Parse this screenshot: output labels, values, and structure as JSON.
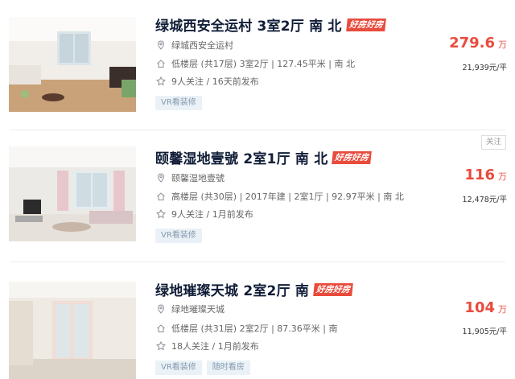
{
  "listings": [
    {
      "title": "绿城西安全运村 3室2厅 南 北",
      "badge": "好房好房",
      "community": "绿城西安全运村",
      "info": "低楼层 (共17层) 3室2厅 | 127.45平米 | 南 北",
      "follow": "9人关注 / 16天前发布",
      "tags": [
        "VR看装修"
      ],
      "price": "279.6",
      "price_unit": "万",
      "unit_price": "21,939元/平"
    },
    {
      "title": "颐馨湿地壹號 2室1厅 南 北",
      "badge": "好房好房",
      "community": "颐馨湿地壹號",
      "info": "高楼层 (共30层) | 2017年建 | 2室1厅 | 92.97平米 | 南 北",
      "follow": "9人关注 / 1月前发布",
      "tags": [
        "VR看装修"
      ],
      "price": "116",
      "price_unit": "万",
      "unit_price": "12,478元/平",
      "follow_button": "关注"
    },
    {
      "title": "绿地璀璨天城 2室2厅 南",
      "badge": "好房好房",
      "community": "绿地璀璨天城",
      "info": "低楼层 (共31层) 2室2厅 | 87.36平米 | 南",
      "follow": "18人关注 / 1月前发布",
      "tags": [
        "VR看装修",
        "随时看房"
      ],
      "price": "104",
      "price_unit": "万",
      "unit_price": "11,905元/平"
    }
  ],
  "icons": {
    "community": "location-pin-icon",
    "info": "house-icon",
    "follow": "star-icon"
  },
  "colors": {
    "accent_red": "#e94b3c",
    "title": "#101d37",
    "tag_bg": "#eaf1f7",
    "tag_text": "#849aae"
  }
}
